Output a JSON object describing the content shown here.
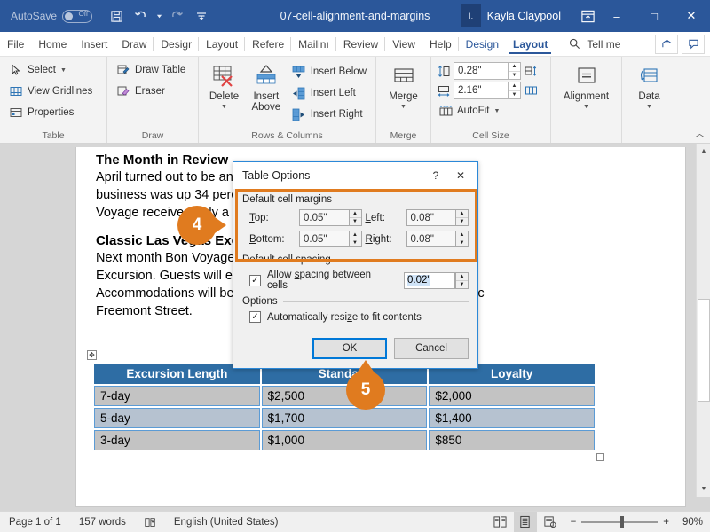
{
  "titlebar": {
    "autosave_label": "AutoSave",
    "autosave_state": "Off",
    "document_title": "07-cell-alignment-and-margins",
    "user_name": "Kayla Claypool",
    "user_initials": "I.",
    "save_icon": "save-icon",
    "undo_icon": "undo-icon",
    "redo_icon": "redo-icon",
    "customize_icon": "customize-quick-access-icon",
    "ribbon_display_icon": "ribbon-display-options-icon",
    "minimize_label": "–",
    "restore_label": "□",
    "close_label": "✕",
    "bg_color": "#2b579a"
  },
  "tabs": [
    {
      "label": "File",
      "state": "normal"
    },
    {
      "label": "Home",
      "state": "normal"
    },
    {
      "label": "Insert",
      "state": "normal"
    },
    {
      "label": "Draw",
      "state": "normal"
    },
    {
      "label": "Desigr",
      "state": "normal"
    },
    {
      "label": "Layout",
      "state": "normal"
    },
    {
      "label": "Refere",
      "state": "normal"
    },
    {
      "label": "Mailinı",
      "state": "normal"
    },
    {
      "label": "Review",
      "state": "normal"
    },
    {
      "label": "View",
      "state": "normal"
    },
    {
      "label": "Help",
      "state": "normal"
    },
    {
      "label": "Design",
      "state": "contextual"
    },
    {
      "label": "Layout",
      "state": "active"
    }
  ],
  "tellme": {
    "label": "Tell me",
    "icon": "search-icon"
  },
  "tab_right": {
    "share_icon": "share-icon",
    "comments_icon": "comments-icon"
  },
  "ribbon": {
    "groups": [
      {
        "name": "Table",
        "label": "Table",
        "items": [
          {
            "label": "Select",
            "icon": "cursor-select-icon",
            "has_caret": true
          },
          {
            "label": "View Gridlines",
            "icon": "gridlines-icon",
            "has_caret": false
          },
          {
            "label": "Properties",
            "icon": "table-properties-icon",
            "has_caret": false
          }
        ]
      },
      {
        "name": "Draw",
        "label": "Draw",
        "items": [
          {
            "label": "Draw Table",
            "icon": "draw-table-icon",
            "has_caret": false
          },
          {
            "label": "Eraser",
            "icon": "eraser-icon",
            "has_caret": false
          }
        ]
      },
      {
        "name": "Rows & Columns",
        "label": "Rows & Columns",
        "big_items": [
          {
            "label": "Delete",
            "icon": "delete-table-icon",
            "has_caret": true
          },
          {
            "label": "Insert Above",
            "icon": "insert-above-icon",
            "has_caret": false
          }
        ],
        "items": [
          {
            "label": "Insert Below",
            "icon": "insert-below-icon"
          },
          {
            "label": "Insert Left",
            "icon": "insert-left-icon"
          },
          {
            "label": "Insert Right",
            "icon": "insert-right-icon"
          }
        ],
        "has_dialog_launcher": true
      },
      {
        "name": "Merge",
        "label": "Merge",
        "big_items": [
          {
            "label": "Merge",
            "icon": "merge-cells-icon",
            "has_caret": true
          }
        ]
      },
      {
        "name": "Cell Size",
        "label": "Cell Size",
        "height_value": "0.28\"",
        "height_icon": "row-height-icon",
        "width_value": "2.16\"",
        "width_icon": "column-width-icon",
        "distribute_rows_icon": "distribute-rows-icon",
        "distribute_cols_icon": "distribute-columns-icon",
        "autofit_label": "AutoFit",
        "autofit_icon": "autofit-icon",
        "has_dialog_launcher": true
      },
      {
        "name": "Alignment",
        "label": "",
        "big_items": [
          {
            "label": "Alignment",
            "icon": "align-center-icon",
            "has_caret": true
          }
        ]
      },
      {
        "name": "Data",
        "label": "",
        "big_items": [
          {
            "label": "Data",
            "icon": "data-repeat-icon",
            "has_caret": true
          }
        ]
      }
    ],
    "collapse_icon": "chevron-up-icon"
  },
  "document": {
    "heading1": "The Month in Review",
    "para1_lines": [
      "April turned out to be another banner month for Bon Voyage. New",
      "business was up 34 percent, and cancellations were minimal—Bon",
      "Voyage received only a handful of requests for a refund or delay."
    ],
    "heading2": "Classic Las Vegas Excursion",
    "para2_lines": [
      "Next month Bon Voyage is proud to launch the “Classic Las Vegas”",
      "Excursion. Guests will enjoy dinner and a show every day.",
      "Accommodations will be at the historic Golden Gate hotel on historic",
      "Freemont Street."
    ],
    "table": {
      "headers": [
        "Excursion Length",
        "Standard",
        "Loyalty"
      ],
      "rows": [
        [
          "7-day",
          "$2,500",
          "$2,000"
        ],
        [
          "5-day",
          "$1,700",
          "$1,400"
        ],
        [
          "3-day",
          "$1,000",
          "$850"
        ]
      ]
    },
    "table_move_handle_icon": "table-move-handle-icon",
    "table_resize_handle_icon": "table-resize-handle-icon"
  },
  "dialog": {
    "title": "Table Options",
    "help_label": "?",
    "close_label": "✕",
    "highlight_color": "#e07b1f",
    "margins_group_label": "Default cell margins",
    "fields": [
      {
        "label": "Top:",
        "underline": "T",
        "value": "0.05\"",
        "name": "top-margin"
      },
      {
        "label": "Left:",
        "underline": "L",
        "value": "0.08\"",
        "name": "left-margin"
      },
      {
        "label": "Bottom:",
        "underline": "B",
        "value": "0.05\"",
        "name": "bottom-margin"
      },
      {
        "label": "Right:",
        "underline": "R",
        "value": "0.08\"",
        "name": "right-margin"
      }
    ],
    "spacing_group_label": "Default cell spacing",
    "spacing_checkbox_label": "Allow spacing between cells",
    "spacing_checkbox_checked": true,
    "spacing_value": "0.02\"",
    "options_group_label": "Options",
    "autoresize_checkbox_label": "Automatically resize to fit contents",
    "autoresize_checkbox_checked": true,
    "ok_label": "OK",
    "cancel_label": "Cancel"
  },
  "callouts": [
    {
      "number": "4",
      "target": "default-cell-margins-group"
    },
    {
      "number": "5",
      "target": "ok-button"
    }
  ],
  "statusbar": {
    "page_label": "Page 1 of 1",
    "word_count": "157 words",
    "proofing_icon": "proofing-errors-icon",
    "language": "English (United States)",
    "read_mode_icon": "read-mode-icon",
    "print_layout_icon": "print-layout-icon",
    "web_layout_icon": "web-layout-icon",
    "zoom_out_label": "−",
    "zoom_in_label": "+",
    "zoom_value": "90%"
  }
}
